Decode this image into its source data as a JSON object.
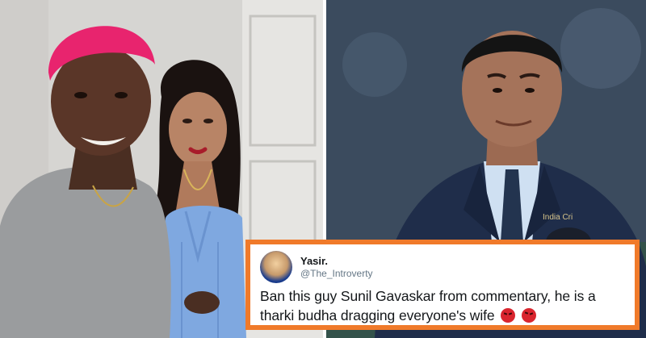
{
  "tweet": {
    "name": "Yasir.",
    "handle": "@The_Introverty",
    "text": "Ban this guy Sunil Gavaskar from commentary, he is a tharki budha dragging everyone's wife",
    "emoji_1": "angry-face",
    "emoji_2": "face-with-symbols-on-mouth"
  },
  "jacket_logo_text": "India Cri",
  "colors": {
    "card_border": "#f07a2a",
    "hair_pink": "#e8246e",
    "dress_blue": "#7fa8e0",
    "blazer_navy": "#1f2d4a"
  }
}
